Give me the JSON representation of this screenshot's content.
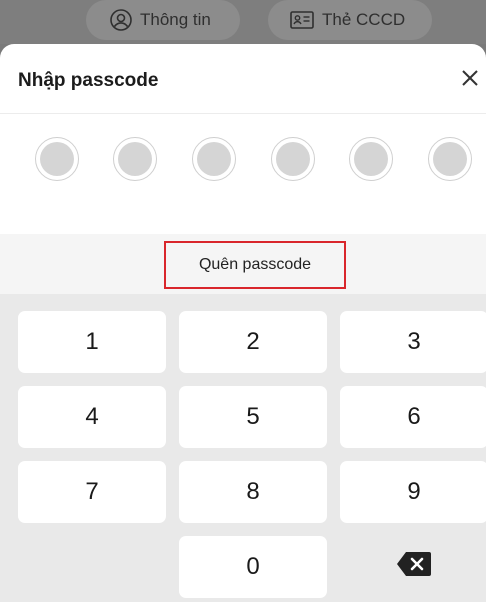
{
  "background": {
    "tabs": [
      {
        "label": "Thông tin",
        "icon": "user-circle-icon"
      },
      {
        "label": "Thẻ CCCD",
        "icon": "id-card-icon"
      }
    ]
  },
  "modal": {
    "title": "Nhập passcode",
    "close_icon": "close-icon",
    "passcode_length": 6,
    "forgot_label": "Quên passcode",
    "highlight_color": "#d9262c"
  },
  "keypad": {
    "keys": [
      "1",
      "2",
      "3",
      "4",
      "5",
      "6",
      "7",
      "8",
      "9",
      "",
      "0",
      "backspace"
    ],
    "backspace_icon": "backspace-icon"
  }
}
